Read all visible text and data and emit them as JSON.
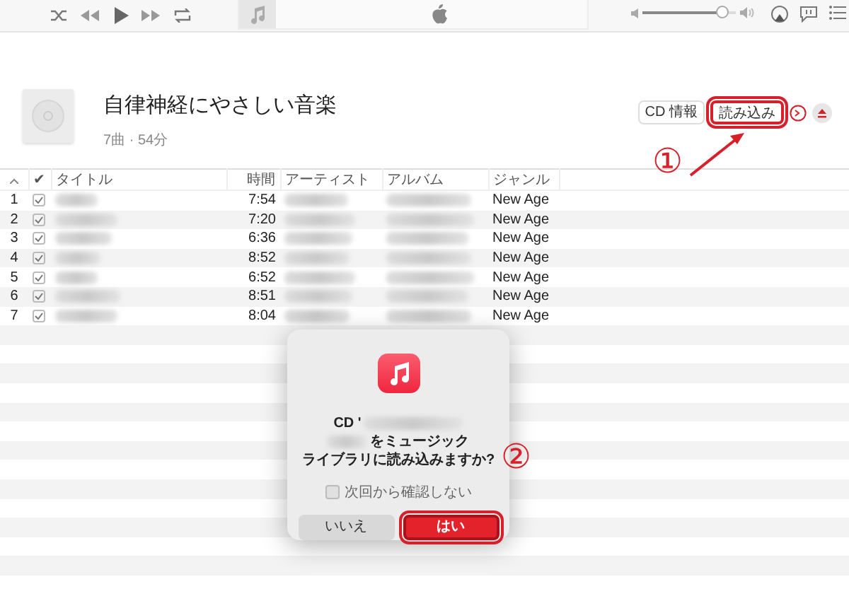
{
  "volume": {
    "level": 0.85
  },
  "album": {
    "title": "自律神経にやさしい音楽",
    "meta": "7曲 · 54分"
  },
  "header_buttons": [
    {
      "label": "CD 情報",
      "highlighted": false
    },
    {
      "label": "読み込み",
      "highlighted": true
    }
  ],
  "table": {
    "check_header": "✔",
    "columns": [
      "タイトル",
      "時間",
      "アーティスト",
      "アルバム",
      "ジャンル"
    ],
    "rows": [
      {
        "number": "1",
        "checked": true,
        "time": "7:54",
        "genre": "New Age"
      },
      {
        "number": "2",
        "checked": true,
        "time": "7:20",
        "genre": "New Age"
      },
      {
        "number": "3",
        "checked": true,
        "time": "6:36",
        "genre": "New Age"
      },
      {
        "number": "4",
        "checked": true,
        "time": "8:52",
        "genre": "New Age"
      },
      {
        "number": "5",
        "checked": true,
        "time": "6:52",
        "genre": "New Age"
      },
      {
        "number": "6",
        "checked": true,
        "time": "8:51",
        "genre": "New Age"
      },
      {
        "number": "7",
        "checked": true,
        "time": "8:04",
        "genre": "New Age"
      }
    ]
  },
  "dialog": {
    "lines": [
      "CD '",
      "をミュージック",
      "ライブラリに読み込みますか?"
    ],
    "checkbox": {
      "label": "次回から確認しない",
      "checked": false
    },
    "buttons": [
      {
        "label": "いいえ",
        "primary": false,
        "highlighted": false
      },
      {
        "label": "はい",
        "primary": true,
        "highlighted": true
      }
    ]
  },
  "annotations": [
    {
      "label": "①"
    },
    {
      "label": "②"
    }
  ]
}
